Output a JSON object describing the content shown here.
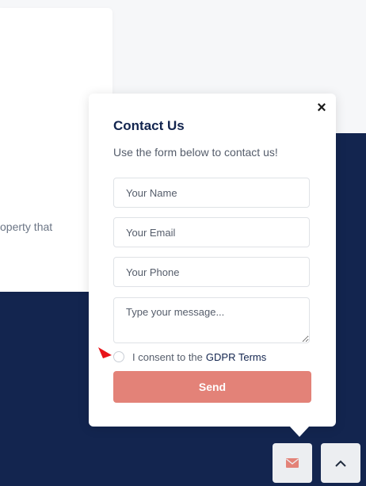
{
  "background": {
    "partial_text": "operty that",
    "navy_color": "#13254f"
  },
  "contact_popup": {
    "title": "Contact Us",
    "subtitle": "Use the form below to contact us!",
    "close_symbol": "×",
    "fields": {
      "name_placeholder": "Your Name",
      "email_placeholder": "Your Email",
      "phone_placeholder": "Your Phone",
      "message_placeholder": "Type your message..."
    },
    "consent": {
      "text": "I consent to the",
      "link_label": "GDPR Terms",
      "checked": false
    },
    "send_label": "Send",
    "send_color": "#e38278"
  },
  "floating_buttons": {
    "mail_icon": "envelope-icon",
    "up_icon": "chevron-up-icon",
    "mail_icon_color": "#e38278"
  }
}
